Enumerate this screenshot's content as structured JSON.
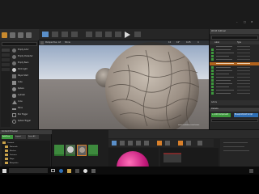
{
  "editor": {
    "window_controls": [
      "–",
      "□",
      "✕"
    ],
    "menu": [
      "File",
      "Edit",
      "Window",
      "Help"
    ],
    "modes_tab": "Modes",
    "search_placeholder": "Search Classes",
    "place_items": [
      "Empty Actor",
      "Empty Character",
      "Empty Pawn",
      "Point Light",
      "Player Start",
      "Cube",
      "Sphere",
      "Cylinder",
      "Cone",
      "Plane",
      "Box Trigger",
      "Sphere Trigger"
    ],
    "toolbar": [
      "Save",
      "Source",
      "Content",
      "Market",
      "Settings",
      "Blueprints",
      "Cinematics",
      "Build",
      "Play",
      "Launch"
    ]
  },
  "viewport": {
    "buttons": [
      "Perspective",
      "Lit",
      "Show"
    ],
    "grid_size": "10",
    "angle": "10°",
    "scale": "0.25",
    "camera_speed": "4",
    "watermark": "www.mediafire.com/xxxxx"
  },
  "outliner": {
    "title": "World Outliner",
    "search_placeholder": "Search...",
    "columns": [
      "Label",
      "Type"
    ],
    "footer": "Actors"
  },
  "details": {
    "title": "Details",
    "add_component": "+ Add Component",
    "blueprint_button": "Blueprint/Add Script"
  },
  "content_browser": {
    "title": "Content Browser",
    "buttons": [
      "Add New",
      "Import",
      "Save All"
    ],
    "folders": [
      "Content",
      "Materials",
      "Meshes",
      "Textures",
      "Maps",
      "Blueprints"
    ]
  },
  "material_editor": {
    "toolbar": [
      "Save",
      "Find",
      "Home",
      "Apply",
      "Search",
      "Clean Up",
      "Connectors",
      "Live Preview",
      "Hide",
      "Stats"
    ]
  },
  "taskbar": {
    "search_placeholder": "Type here to search"
  },
  "colors": {
    "accent": "#d9802a",
    "panel_bg": "#2a2a2a",
    "header_bg": "#3b3b3b",
    "green": "#3d9a3d",
    "outliner_highlight": "#b0621c"
  }
}
